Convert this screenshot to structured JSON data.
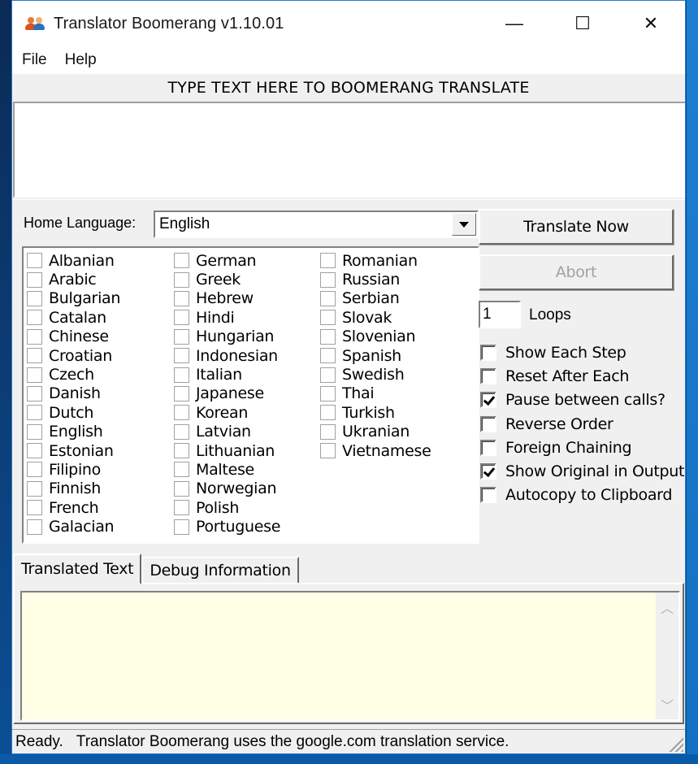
{
  "window": {
    "title": "Translator Boomerang v1.10.01",
    "icon": "people-icon",
    "controls": {
      "minimize": "—",
      "maximize": "☐",
      "close": "✕"
    }
  },
  "menu": [
    "File",
    "Help"
  ],
  "input": {
    "label": "TYPE TEXT HERE TO BOOMERANG TRANSLATE",
    "value": ""
  },
  "home_language": {
    "label": "Home Language:",
    "selected": "English"
  },
  "languages": {
    "columns": [
      [
        {
          "name": "Albanian",
          "checked": false
        },
        {
          "name": "Arabic",
          "checked": false
        },
        {
          "name": "Bulgarian",
          "checked": false
        },
        {
          "name": "Catalan",
          "checked": false
        },
        {
          "name": "Chinese",
          "checked": false
        },
        {
          "name": "Croatian",
          "checked": false
        },
        {
          "name": "Czech",
          "checked": false
        },
        {
          "name": "Danish",
          "checked": false
        },
        {
          "name": "Dutch",
          "checked": false
        },
        {
          "name": "English",
          "checked": false
        },
        {
          "name": "Estonian",
          "checked": false
        },
        {
          "name": "Filipino",
          "checked": false
        },
        {
          "name": "Finnish",
          "checked": false
        },
        {
          "name": "French",
          "checked": false
        },
        {
          "name": "Galacian",
          "checked": false
        }
      ],
      [
        {
          "name": "German",
          "checked": false
        },
        {
          "name": "Greek",
          "checked": false
        },
        {
          "name": "Hebrew",
          "checked": false
        },
        {
          "name": "Hindi",
          "checked": false
        },
        {
          "name": "Hungarian",
          "checked": false
        },
        {
          "name": "Indonesian",
          "checked": false
        },
        {
          "name": "Italian",
          "checked": false
        },
        {
          "name": "Japanese",
          "checked": false
        },
        {
          "name": "Korean",
          "checked": false
        },
        {
          "name": "Latvian",
          "checked": false
        },
        {
          "name": "Lithuanian",
          "checked": false
        },
        {
          "name": "Maltese",
          "checked": false
        },
        {
          "name": "Norwegian",
          "checked": false
        },
        {
          "name": "Polish",
          "checked": false
        },
        {
          "name": "Portuguese",
          "checked": false
        }
      ],
      [
        {
          "name": "Romanian",
          "checked": false
        },
        {
          "name": "Russian",
          "checked": false
        },
        {
          "name": "Serbian",
          "checked": false
        },
        {
          "name": "Slovak",
          "checked": false
        },
        {
          "name": "Slovenian",
          "checked": false
        },
        {
          "name": "Spanish",
          "checked": false
        },
        {
          "name": "Swedish",
          "checked": false
        },
        {
          "name": "Thai",
          "checked": false
        },
        {
          "name": "Turkish",
          "checked": false
        },
        {
          "name": "Ukranian",
          "checked": false
        },
        {
          "name": "Vietnamese",
          "checked": false
        }
      ]
    ]
  },
  "buttons": {
    "translate": "Translate Now",
    "abort": "Abort",
    "abort_enabled": false
  },
  "loops": {
    "value": "1",
    "label": "Loops"
  },
  "options": [
    {
      "label": "Show Each Step",
      "checked": false
    },
    {
      "label": "Reset After Each",
      "checked": false
    },
    {
      "label": "Pause between calls?",
      "checked": true
    },
    {
      "label": "Reverse Order",
      "checked": false
    },
    {
      "label": "Foreign Chaining",
      "checked": false
    },
    {
      "label": "Show Original in Output",
      "checked": true
    },
    {
      "label": "Autocopy to Clipboard",
      "checked": false
    }
  ],
  "tabs": [
    {
      "label": "Translated Text",
      "active": true
    },
    {
      "label": "Debug Information",
      "active": false
    }
  ],
  "output": {
    "value": ""
  },
  "status": {
    "state": "Ready.",
    "message": "Translator Boomerang uses the google.com translation service."
  }
}
